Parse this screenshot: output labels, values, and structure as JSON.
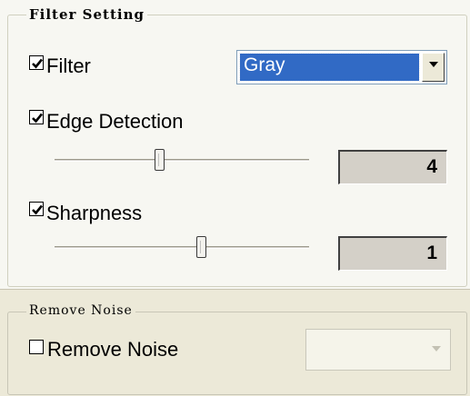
{
  "filter_setting": {
    "legend": "Filter Setting",
    "filter": {
      "label": "Filter",
      "checked": true,
      "selected": "Gray"
    },
    "edge_detection": {
      "label": "Edge Detection",
      "checked": true,
      "slider_fraction": 0.41,
      "value": "4"
    },
    "sharpness": {
      "label": "Sharpness",
      "checked": true,
      "slider_fraction": 0.58,
      "value": "1"
    }
  },
  "remove_noise": {
    "legend": "Remove Noise",
    "checkbox": {
      "label": "Remove Noise",
      "checked": false
    },
    "dropdown_disabled": true
  },
  "icons": {
    "check": "checkmark-icon",
    "dropdown": "chevron-down-icon"
  },
  "colors": {
    "selection": "#316ac5",
    "panel": "#ece9d8"
  }
}
